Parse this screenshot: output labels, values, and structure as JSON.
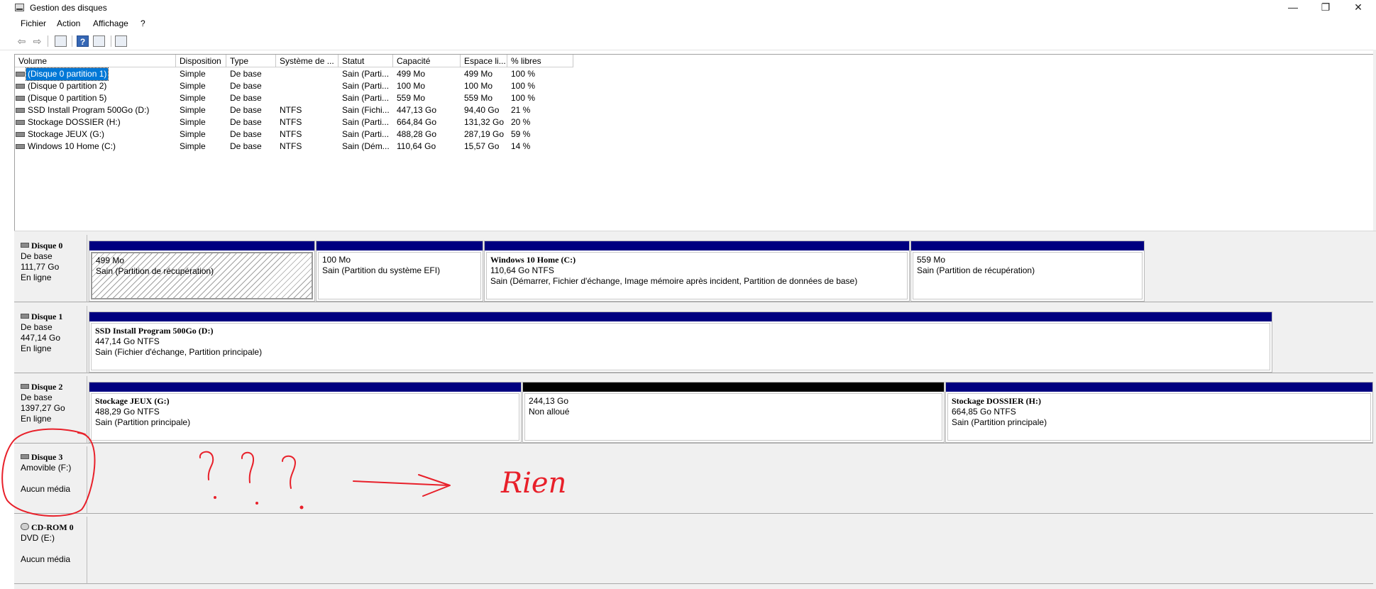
{
  "window": {
    "title": "Gestion des disques",
    "minimize_glyph": "—",
    "maximize_glyph": "❐",
    "close_glyph": "✕"
  },
  "menu": [
    "Fichier",
    "Action",
    "Affichage",
    "?"
  ],
  "toolbar": {
    "icons": [
      "back-arrow-icon",
      "forward-arrow-icon",
      "disk-list-icon",
      "help-icon",
      "properties-icon",
      "console-icon"
    ],
    "back_glyph": "⇦",
    "forward_glyph": "⇨",
    "help_glyph": "?"
  },
  "volume_list": {
    "columns": [
      "Volume",
      "Disposition",
      "Type",
      "Système de ...",
      "Statut",
      "Capacité",
      "Espace li...",
      "% libres"
    ],
    "rows": [
      {
        "volume": "(Disque 0 partition 1)",
        "disposition": "Simple",
        "type": "De base",
        "fs": "",
        "status": "Sain (Parti...",
        "capacity": "499 Mo",
        "free": "499 Mo",
        "pct": "100 %"
      },
      {
        "volume": "(Disque 0 partition 2)",
        "disposition": "Simple",
        "type": "De base",
        "fs": "",
        "status": "Sain (Parti...",
        "capacity": "100 Mo",
        "free": "100 Mo",
        "pct": "100 %"
      },
      {
        "volume": "(Disque 0 partition 5)",
        "disposition": "Simple",
        "type": "De base",
        "fs": "",
        "status": "Sain (Parti...",
        "capacity": "559 Mo",
        "free": "559 Mo",
        "pct": "100 %"
      },
      {
        "volume": "SSD Install Program 500Go (D:)",
        "disposition": "Simple",
        "type": "De base",
        "fs": "NTFS",
        "status": "Sain (Fichi...",
        "capacity": "447,13 Go",
        "free": "94,40 Go",
        "pct": "21 %"
      },
      {
        "volume": "Stockage DOSSIER (H:)",
        "disposition": "Simple",
        "type": "De base",
        "fs": "NTFS",
        "status": "Sain (Parti...",
        "capacity": "664,84 Go",
        "free": "131,32 Go",
        "pct": "20 %"
      },
      {
        "volume": "Stockage JEUX (G:)",
        "disposition": "Simple",
        "type": "De base",
        "fs": "NTFS",
        "status": "Sain (Parti...",
        "capacity": "488,28 Go",
        "free": "287,19 Go",
        "pct": "59 %"
      },
      {
        "volume": "Windows 10 Home (C:)",
        "disposition": "Simple",
        "type": "De base",
        "fs": "NTFS",
        "status": "Sain (Dém...",
        "capacity": "110,64 Go",
        "free": "15,57 Go",
        "pct": "14 %"
      }
    ]
  },
  "disks": [
    {
      "name": "Disque 0",
      "line1": "De base",
      "line2": "111,77 Go",
      "line3": "En ligne",
      "partitions": [
        {
          "title": "",
          "size": "499 Mo",
          "status": "Sain (Partition de récupération)"
        },
        {
          "title": "",
          "size": "100 Mo",
          "status": "Sain (Partition du système EFI)"
        },
        {
          "title": "Windows 10 Home  (C:)",
          "size": "110,64 Go NTFS",
          "status": "Sain (Démarrer, Fichier d'échange, Image mémoire après incident, Partition de données de base)"
        },
        {
          "title": "",
          "size": "559 Mo",
          "status": "Sain (Partition de récupération)"
        }
      ]
    },
    {
      "name": "Disque 1",
      "line1": "De base",
      "line2": "447,14 Go",
      "line3": "En ligne",
      "partitions": [
        {
          "title": "SSD Install Program 500Go  (D:)",
          "size": "447,14 Go NTFS",
          "status": "Sain (Fichier d'échange, Partition principale)"
        }
      ]
    },
    {
      "name": "Disque 2",
      "line1": "De base",
      "line2": "1397,27 Go",
      "line3": "En ligne",
      "partitions": [
        {
          "title": "Stockage JEUX  (G:)",
          "size": "488,29 Go NTFS",
          "status": "Sain (Partition principale)"
        },
        {
          "title": "",
          "size": "244,13 Go",
          "status": "Non alloué"
        },
        {
          "title": "Stockage DOSSIER  (H:)",
          "size": "664,85 Go NTFS",
          "status": "Sain (Partition principale)"
        }
      ]
    },
    {
      "name": "Disque 3",
      "line1": "Amovible (F:)",
      "line2": "",
      "line3": "Aucun média"
    },
    {
      "name": "CD-ROM 0",
      "line1": "DVD (E:)",
      "line2": "",
      "line3": "Aucun média"
    }
  ],
  "annotation": {
    "text": "Rien",
    "color": "#e8202a"
  },
  "colors": {
    "primary_bar": "#000080",
    "unallocated_bar": "#000000",
    "selection": "#0078d7"
  }
}
